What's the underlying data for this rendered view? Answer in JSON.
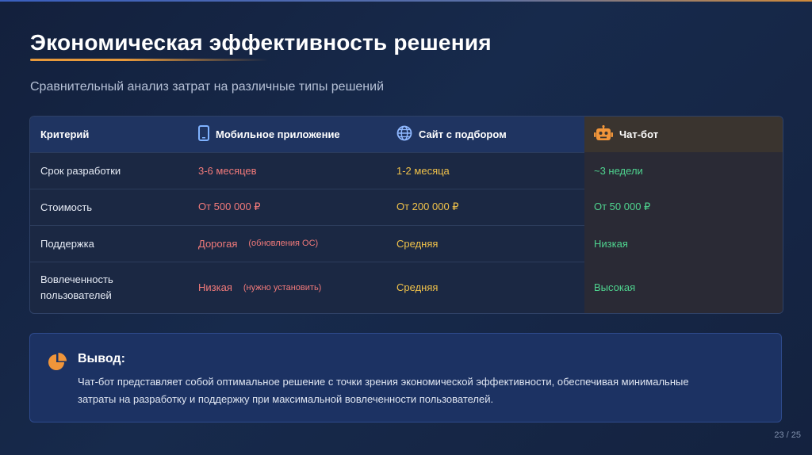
{
  "slide": {
    "title": "Экономическая эффективность решения",
    "subtitle": "Сравнительный анализ затрат на различные типы решений",
    "page": "23 / 25"
  },
  "table": {
    "headers": [
      "Критерий",
      "Мобильное приложение",
      "Сайт с подбором",
      "Чат-бот"
    ],
    "header_icons": [
      "",
      "smartphone-icon",
      "globe-icon",
      "robot-icon"
    ],
    "rows": [
      {
        "criterion": "Срок разработки",
        "mobile": "3-6 месяцев",
        "mobile_note": "",
        "site": "1-2 месяца",
        "bot": "~3 недели"
      },
      {
        "criterion": "Стоимость",
        "mobile": "От 500 000 ₽",
        "mobile_note": "",
        "site": "От 200 000 ₽",
        "bot": "От 50 000 ₽"
      },
      {
        "criterion": "Поддержка",
        "mobile": "Дорогая",
        "mobile_note": "(обновления ОС)",
        "site": "Средняя",
        "bot": "Низкая"
      },
      {
        "criterion_line1": "Вовлеченность",
        "criterion_line2": "пользователей",
        "mobile": "Низкая",
        "mobile_note": "(нужно установить)",
        "site": "Средняя",
        "bot": "Высокая"
      }
    ]
  },
  "conclusion": {
    "icon": "pie-chart-icon",
    "title": "Вывод:",
    "text": "Чат-бот представляет собой оптимальное решение с точки зрения экономической эффективности, обеспечивая минимальные затраты на разработку и поддержку при максимальной вовлеченности пользователей."
  },
  "colors": {
    "accent": "#e89a3c",
    "negative": "#f27a7a",
    "neutral": "#f0c24a",
    "positive": "#4fd48f"
  }
}
